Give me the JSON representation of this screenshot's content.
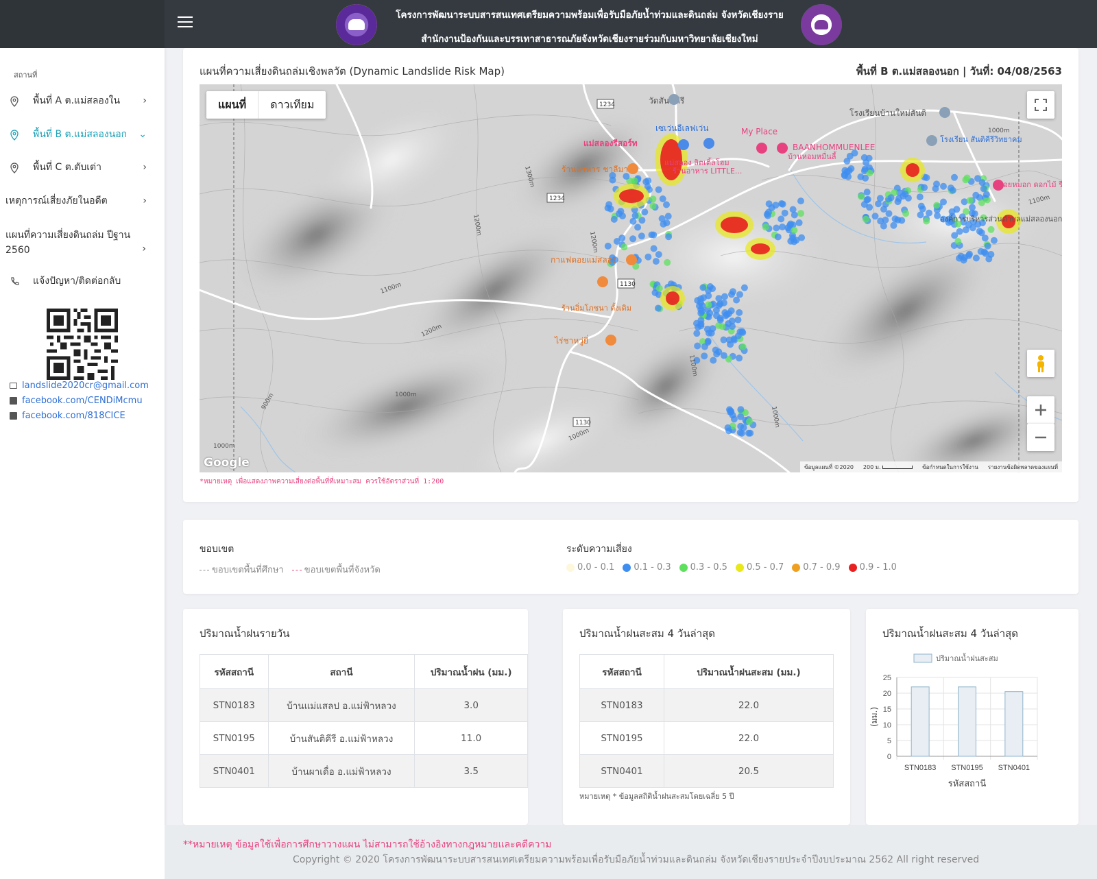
{
  "header": {
    "title_line1": "โครงการพัฒนาระบบสารสนเทศเตรียมความพร้อมเพื่อรับมือภัยน้ำท่วมและดินถล่ม จังหวัดเชียงราย",
    "title_line2": "สำนักงานป้องกันและบรรเทาสาธารณภัยจังหวัดเชียงรายร่วมกับมหาวิทยาลัยเชียงใหม่",
    "menu_icon": "hamburger-icon"
  },
  "sidebar": {
    "section_label": "สถานที่",
    "items": [
      {
        "label": "พื้นที่ A ต.แม่สลองใน",
        "icon": "map-pin-icon",
        "chevron": "›"
      },
      {
        "label": "พื้นที่ B ต.แม่สลองนอก",
        "icon": "map-pin-icon",
        "chevron": "⌄"
      },
      {
        "label": "พื้นที่ C ต.ตับเต่า",
        "icon": "map-pin-icon",
        "chevron": "›"
      },
      {
        "label": "เหตุการณ์เสี่ยงภัยในอดีต",
        "chevron": "›"
      },
      {
        "label": "แผนที่ความเสี่ยงดินถล่ม ปีฐาน 2560",
        "chevron": "›"
      },
      {
        "label": "แจ้งปัญหา/ติดต่อกลับ",
        "icon": "phone-icon"
      }
    ],
    "contacts": [
      {
        "label": "landslide2020cr@gmail.com",
        "icon": "mail-icon"
      },
      {
        "label": "facebook.com/CENDiMcmu",
        "icon": "facebook-icon"
      },
      {
        "label": "facebook.com/818CICE",
        "icon": "facebook-icon"
      }
    ]
  },
  "map": {
    "title": "แผนที่ความเสี่ยงดินถล่มเชิงพลวัต (Dynamic Landslide Risk Map)",
    "area_date": "พื้นที่ B ต.แม่สลองนอก | วันที่: 04/08/2563",
    "tab_map": "แผนที่",
    "tab_satellite": "ดาวเทียม",
    "note": "*หมายเหตุ เพื่อแสดงภาพความเสี่ยงต่อพื้นที่ที่เหมาะสม ควรใช้อัตราส่วนที่ 1:200",
    "google": "Google",
    "attribution": [
      "ข้อมูลแผนที่ ©2020",
      "200 ม.",
      "ข้อกำหนดในการใช้งาน",
      "รายงานข้อผิดพลาดของแผนที่"
    ],
    "places": [
      "วัดสันติคีรี",
      "แม่สลองรีสอร์ท",
      "เซเว่นอีเลฟเว่น",
      "My Place",
      "BAANHOMMUENLEE",
      "บ้านหอมหมื่นลี้",
      "โรงเรียนบ้านใหม่สันติ",
      "ร้านอาหาร ชาลีมา",
      "แม่สลอง ลิตเติ้ลโฮม",
      "ร้านอาหาร LITTLE...",
      "โรงเรียน สันติคีรีวิทยาคม",
      "ดอยหมอก ดอกไม้ รีสอร์ท",
      "องค์การบริหารส่วนตำบลแม่สลองนอก",
      "กาแฟดอยแม่สลอง",
      "ร้านอิ่มโภชนา ดั้งเดิม",
      "ไร่ชาหวู่ยี่",
      "1234",
      "1130"
    ]
  },
  "legend": {
    "boundary_title": "ขอบเขต",
    "boundary_items": [
      {
        "label": "ขอบเขตพื้นที่ศึกษา",
        "color": "#888888"
      },
      {
        "label": "ขอบเขตพื้นที่จังหวัด",
        "color": "#e8417f"
      }
    ],
    "risk_title": "ระดับความเสี่ยง",
    "risk_items": [
      {
        "label": "0.0 - 0.1",
        "color": "#fdf7dc"
      },
      {
        "label": "0.1 - 0.3",
        "color": "#3d8ef0"
      },
      {
        "label": "0.3 - 0.5",
        "color": "#5ee05e"
      },
      {
        "label": "0.5 - 0.7",
        "color": "#e8e81a"
      },
      {
        "label": "0.7 - 0.9",
        "color": "#f0a020"
      },
      {
        "label": "0.9 - 1.0",
        "color": "#e82020"
      }
    ]
  },
  "daily_rain": {
    "title": "ปริมาณน้ำฝนรายวัน",
    "headers": [
      "รหัสสถานี",
      "สถานี",
      "ปริมาณน้ำฝน (มม.)"
    ],
    "rows": [
      [
        "STN0183",
        "บ้านแม่แสลป อ.แม่ฟ้าหลวง",
        "3.0"
      ],
      [
        "STN0195",
        "บ้านสันติคีรี อ.แม่ฟ้าหลวง",
        "11.0"
      ],
      [
        "STN0401",
        "บ้านผาเดื่อ อ.แม่ฟ้าหลวง",
        "3.5"
      ]
    ]
  },
  "accum_rain": {
    "title": "ปริมาณน้ำฝนสะสม 4 วันล่าสุด",
    "headers": [
      "รหัสสถานี",
      "ปริมาณน้ำฝนสะสม (มม.)"
    ],
    "rows": [
      [
        "STN0183",
        "22.0"
      ],
      [
        "STN0195",
        "22.0"
      ],
      [
        "STN0401",
        "20.5"
      ]
    ],
    "note": "หมายเหตุ * ข้อมูลสถิติน้ำฝนสะสมโดยเฉลี่ย 5 ปี"
  },
  "chart_card": {
    "title": "ปริมาณน้ำฝนสะสม 4 วันล่าสุด"
  },
  "chart_data": {
    "type": "bar",
    "categories": [
      "STN0183",
      "STN0195",
      "STN0401"
    ],
    "series": [
      {
        "name": "ปริมาณน้ำฝนสะสม",
        "values": [
          22.0,
          22.0,
          20.5
        ]
      }
    ],
    "xlabel": "รหัสสถานี",
    "ylabel": "(มม.)",
    "ylim": [
      0,
      25
    ],
    "yticks": [
      0,
      5,
      10,
      15,
      20,
      25
    ],
    "grid": true,
    "legend": "top",
    "bar_fill": "#e8eef3",
    "bar_stroke": "#8fb3cc"
  },
  "footer": {
    "note": "**หมายเหตุ ข้อมูลใช้เพื่อการศึกษาวางแผน ไม่สามารถใช้อ้างอิงทางกฎหมายและคดีความ",
    "copyright": "Copyright © 2020 โครงการพัฒนาระบบสารสนเทศเตรียมความพร้อมเพื่อรับมือภัยน้ำท่วมและดินถล่ม จังหวัดเชียงรายประจำปีงบประมาณ 2562 All right reserved"
  }
}
